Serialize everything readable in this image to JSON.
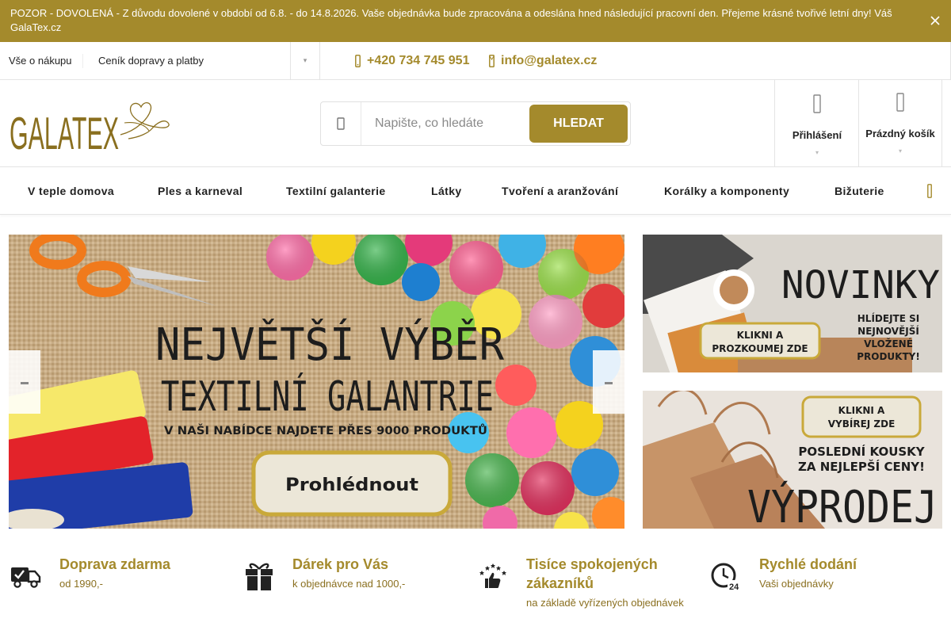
{
  "notice": {
    "text": "POZOR - DOVOLENÁ - Z důvodu dovolené v období od 6.8. - do 14.8.2026. Vaše objednávka bude zpracována a odeslána hned následující pracovní den. Přejeme krásné tvořivé letní dny! Váš GalaTex.cz",
    "close_icon": "close-icon"
  },
  "topbar": {
    "links": [
      "Vše o nákupu",
      "Ceník dopravy a platby"
    ],
    "more_icon": "chevron-down-icon",
    "phone": "+420 734 745 951",
    "phone_icon": "phone-icon",
    "email": "info@galatex.cz",
    "email_icon": "mail-icon"
  },
  "header": {
    "logo_text": "GALATEX",
    "search": {
      "placeholder": "Napište, co hledáte",
      "button": "HLEDAT",
      "icon": "search-icon"
    },
    "login": {
      "label": "Přihlášení",
      "icon": "user-icon"
    },
    "cart": {
      "label": "Prázdný košík",
      "icon": "cart-icon"
    }
  },
  "nav": {
    "items": [
      "V teple domova",
      "Ples a karneval",
      "Textilní galanterie",
      "Látky",
      "Tvoření a aranžování",
      "Korálky a komponenty",
      "Bižuterie"
    ],
    "more_icon": "menu-icon"
  },
  "hero": {
    "title_line1": "NEJVĚTŠÍ VÝBĚR",
    "title_line2": "TEXTILNÍ GALANTRIE",
    "subtitle": "V NAŠI NABÍDCE NAJDETE PŘES 9000 PRODUKTŮ",
    "button": "Prohlédnout"
  },
  "promo_novinky": {
    "title": "NOVINKY",
    "badge_line1": "KLIKNI A",
    "badge_line2": "PROZKOUMEJ ZDE",
    "text_line1": "HLÍDEJTE SI",
    "text_line2": "NEJNOVĚJŠÍ",
    "text_line3": "VLOŽENÉ",
    "text_line4": "PRODUKTY!"
  },
  "promo_vyprodej": {
    "badge_line1": "KLIKNI A",
    "badge_line2": "VYBÍREJ ZDE",
    "text_line1": "POSLEDNÍ KOUSKY",
    "text_line2": "ZA NEJLEPŠÍ CENY!",
    "title": "VÝPRODEJ"
  },
  "features": [
    {
      "title": "Doprava zdarma",
      "sub": "od 1990,-",
      "icon": "truck-icon"
    },
    {
      "title": "Dárek pro Vás",
      "sub": "k objednávce nad 1000,-",
      "icon": "gift-icon"
    },
    {
      "title": "Tisíce spokojených zákazníků",
      "sub": "na základě vyřízených objednávek",
      "icon": "thumbs-up-stars-icon"
    },
    {
      "title": "Rychlé dodání",
      "sub": "Vaši objednávky",
      "icon": "clock-24-icon"
    }
  ],
  "colors": {
    "brand": "#a48a2c",
    "brand_dark": "#8a6f1f"
  }
}
